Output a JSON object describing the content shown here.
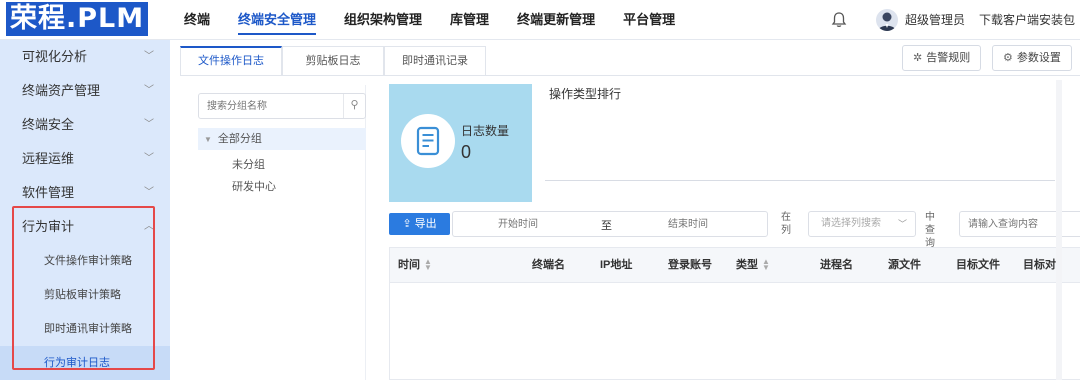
{
  "app": {
    "logo": "荣程.PLM"
  },
  "topnav": {
    "items": [
      {
        "label": "终端"
      },
      {
        "label": "终端安全管理"
      },
      {
        "label": "组织架构管理"
      },
      {
        "label": "库管理"
      },
      {
        "label": "终端更新管理"
      },
      {
        "label": "平台管理"
      }
    ],
    "active_index": 1
  },
  "header": {
    "bell_icon": "bell-icon",
    "user_name": "超级管理员",
    "download_label": "下载客户端安装包"
  },
  "sidebar": {
    "items": [
      {
        "label": "可视化分析"
      },
      {
        "label": "终端资产管理"
      },
      {
        "label": "终端安全"
      },
      {
        "label": "远程运维"
      },
      {
        "label": "软件管理"
      },
      {
        "label": "行为审计"
      }
    ],
    "subitems": [
      {
        "label": "文件操作审计策略"
      },
      {
        "label": "剪贴板审计策略"
      },
      {
        "label": "即时通讯审计策略"
      },
      {
        "label": "行为审计日志"
      }
    ],
    "active_sub_index": 3
  },
  "tabs": {
    "items": [
      {
        "label": "文件操作日志"
      },
      {
        "label": "剪贴板日志"
      },
      {
        "label": "即时通讯记录"
      }
    ],
    "active_index": 0
  },
  "actions": {
    "alarm_rules": "告警规则",
    "param_settings": "参数设置"
  },
  "group_panel": {
    "search_placeholder": "搜索分组名称",
    "root_label": "全部分组",
    "children": [
      "未分组",
      "研发中心"
    ]
  },
  "stats": {
    "log_count_label": "日志数量",
    "log_count_value": "0",
    "ranking_title": "操作类型排行"
  },
  "toolbar": {
    "export_label": "导出",
    "start_placeholder": "开始时间",
    "range_separator": "至",
    "end_placeholder": "结束时间",
    "in_column_label": "在列",
    "column_select_placeholder": "请选择列搜索",
    "query_label": "中查询",
    "query_placeholder": "请输入查询内容"
  },
  "table": {
    "columns": [
      "时间",
      "终端名",
      "IP地址",
      "登录账号",
      "类型",
      "进程名",
      "源文件",
      "目标文件",
      "目标对"
    ],
    "rows": []
  },
  "colors": {
    "brand": "#1d58c8",
    "sidebar_bg": "#dbe8fb",
    "stat_card": "#a9daef",
    "export_button": "#2b7be0",
    "highlight_box": "#e54848"
  }
}
